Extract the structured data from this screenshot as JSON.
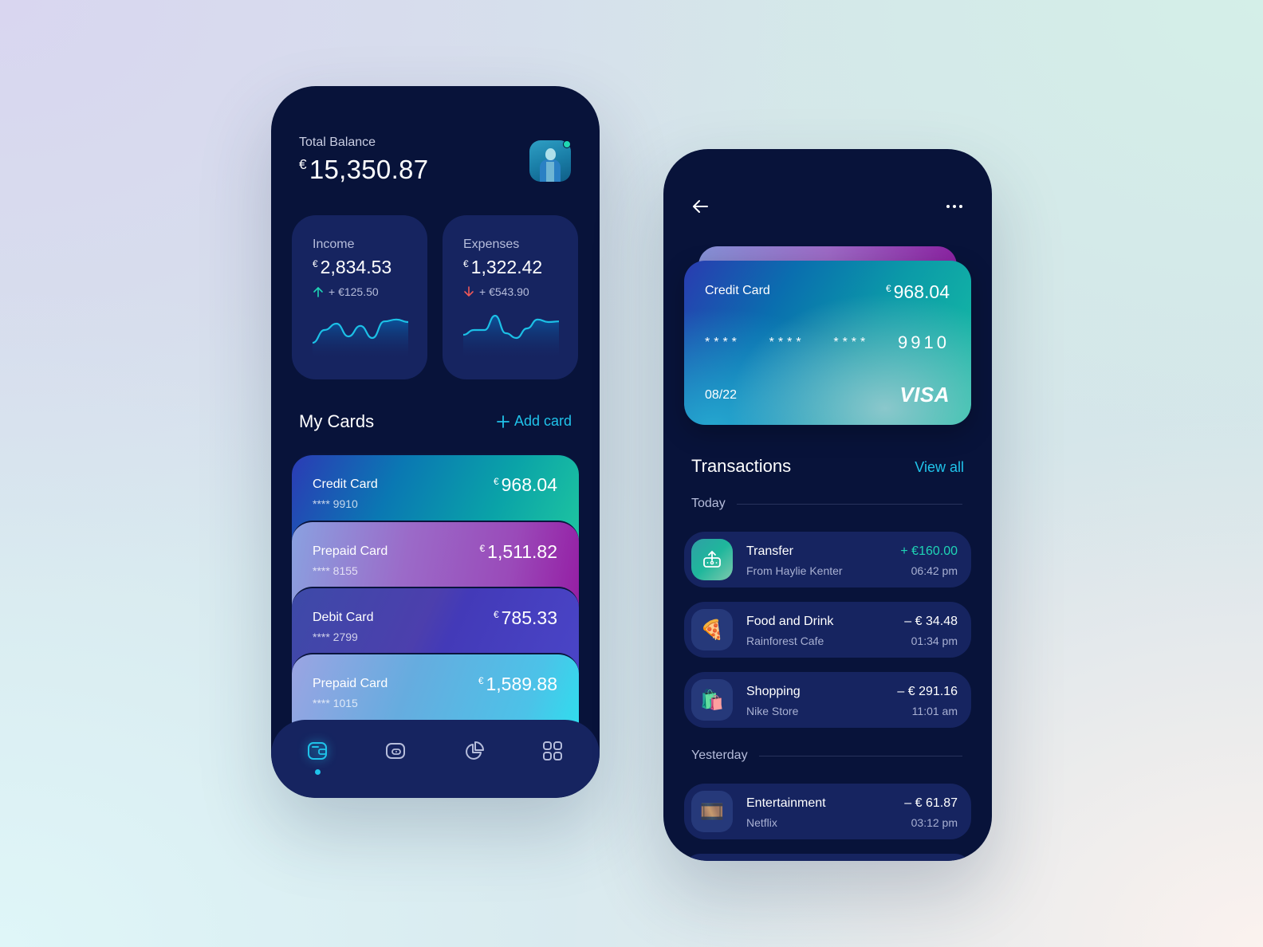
{
  "left_screen": {
    "balance": {
      "label": "Total Balance",
      "currency": "€",
      "amount": "15,350.87"
    },
    "avatar": {
      "online": true,
      "status_color": "#20d6b2"
    },
    "income": {
      "title": "Income",
      "currency": "€",
      "amount": "2,834.53",
      "change": "+ €125.50",
      "direction": "up",
      "color": "#1fd4b5",
      "sparkline": [
        0.05,
        0.45,
        0.65,
        0.25,
        0.58,
        0.2,
        0.72,
        0.78,
        0.7
      ]
    },
    "expenses": {
      "title": "Expenses",
      "currency": "€",
      "amount": "1,322.42",
      "change": "+ €543.90",
      "direction": "down",
      "color": "#f05858",
      "sparkline": [
        0.3,
        0.45,
        0.45,
        0.9,
        0.35,
        0.2,
        0.5,
        0.78,
        0.7,
        0.72
      ]
    },
    "my_cards": {
      "title": "My Cards",
      "add_label": "Add card",
      "cards": [
        {
          "name": "Credit Card",
          "number": "**** 9910",
          "currency": "€",
          "amount": "968.04"
        },
        {
          "name": "Prepaid Card",
          "number": "**** 8155",
          "currency": "€",
          "amount": "1,511.82"
        },
        {
          "name": "Debit Card",
          "number": "**** 2799",
          "currency": "€",
          "amount": "785.33"
        },
        {
          "name": "Prepaid Card",
          "number": "**** 1015",
          "currency": "€",
          "amount": "1,589.88"
        }
      ]
    },
    "bottom_nav": {
      "items": [
        {
          "icon": "wallet-icon",
          "active": true
        },
        {
          "icon": "card-icon",
          "active": false
        },
        {
          "icon": "pie-chart-icon",
          "active": false
        },
        {
          "icon": "grid-icon",
          "active": false
        }
      ],
      "accent": "#1fc3ea"
    }
  },
  "right_screen": {
    "header": {
      "back_icon": "arrow-left-icon",
      "more_icon": "more-horizontal-icon"
    },
    "card": {
      "name": "Credit Card",
      "currency": "€",
      "amount": "968.04",
      "masked_groups": [
        "****",
        "****",
        "****"
      ],
      "last4": "9910",
      "expiry": "08/22",
      "brand": "VISA"
    },
    "transactions": {
      "title": "Transactions",
      "view_all": "View all",
      "groups": [
        {
          "label": "Today"
        },
        {
          "label": "Yesterday"
        }
      ],
      "items": [
        {
          "name": "Transfer",
          "sub": "From Haylie Kenter",
          "amount": "+ €160.00",
          "time": "06:42 pm",
          "icon": "transfer-icon",
          "glyph": "",
          "positive": true
        },
        {
          "name": "Food and Drink",
          "sub": "Rainforest Cafe",
          "amount": "– € 34.48",
          "time": "01:34 pm",
          "icon": "pizza-icon",
          "glyph": "🍕",
          "positive": false
        },
        {
          "name": "Shopping",
          "sub": "Nike Store",
          "amount": "– € 291.16",
          "time": "11:01 am",
          "icon": "shopping-bags-icon",
          "glyph": "🛍️",
          "positive": false
        },
        {
          "name": "Entertainment",
          "sub": "Netflix",
          "amount": "– € 61.87",
          "time": "03:12 pm",
          "icon": "film-icon",
          "glyph": "🎞️",
          "positive": false
        }
      ]
    }
  }
}
